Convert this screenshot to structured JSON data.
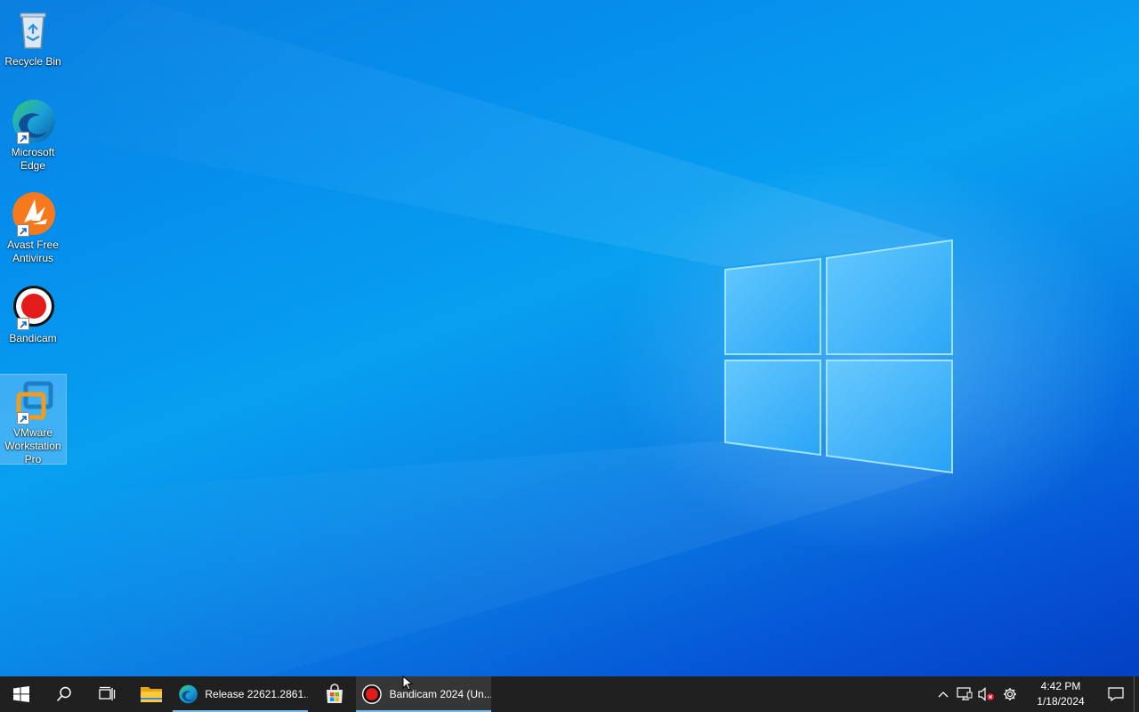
{
  "desktop": {
    "icons": [
      {
        "label": "Recycle Bin",
        "icon": "recycle-bin-icon",
        "shortcut": false
      },
      {
        "label": "Microsoft Edge",
        "icon": "edge-icon",
        "shortcut": true
      },
      {
        "label": "Avast Free Antivirus",
        "icon": "avast-icon",
        "shortcut": true
      },
      {
        "label": "Bandicam",
        "icon": "bandicam-icon",
        "shortcut": true
      },
      {
        "label": "VMware Workstation Pro",
        "icon": "vmware-icon",
        "shortcut": true,
        "selected": true
      }
    ]
  },
  "taskbar": {
    "start_icon": "windows-start-icon",
    "search_icon": "search-icon",
    "task_view_icon": "task-view-icon",
    "pinned": [
      {
        "icon": "file-explorer-icon"
      },
      {
        "icon": "edge-icon",
        "label": "Release 22621.2861....",
        "running": true
      },
      {
        "icon": "microsoft-store-icon"
      },
      {
        "icon": "bandicam-icon",
        "label": "Bandicam 2024 (Un...",
        "running": true,
        "active": true
      }
    ],
    "tray": {
      "icons": [
        "chevron-up-icon",
        "network-icon",
        "volume-muted-icon",
        "settings-gear-icon"
      ],
      "time": "4:42 PM",
      "date": "1/18/2024",
      "notification_icon": "action-center-icon"
    }
  },
  "colors": {
    "taskbar_bg": "#202020",
    "accent_underline": "#76b9ed",
    "desktop_blue": "#0a8ae8"
  }
}
